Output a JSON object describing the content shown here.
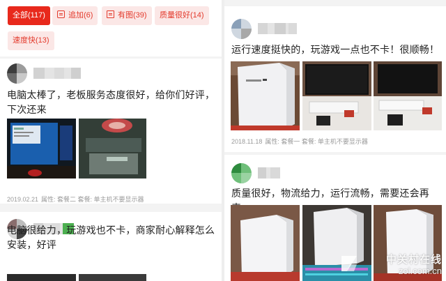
{
  "filters": [
    {
      "label": "全部(117)",
      "active": true,
      "icon": ""
    },
    {
      "label": "追加(6)",
      "active": false,
      "icon": "append-icon"
    },
    {
      "label": "有图(39)",
      "active": false,
      "icon": "image-icon"
    },
    {
      "label": "质量很好(14)",
      "active": false,
      "icon": ""
    },
    {
      "label": "速度快(13)",
      "active": false,
      "icon": ""
    }
  ],
  "reviews_left": [
    {
      "text": "电脑太棒了，老板服务态度很好，给你们好评，下次还来",
      "date": "2019.02.21",
      "attr": "属性: 套餐二 套餐: 单主机不要显示器"
    },
    {
      "text": "电脑很给力，玩游戏也不卡，商家耐心解释怎么安装，好评"
    }
  ],
  "reviews_right": [
    {
      "text": "运行速度挺快的，玩游戏一点也不卡！很顺畅！",
      "date": "2018.11.18",
      "attr": "属性: 套餐一 套餐: 单主机不要显示器"
    },
    {
      "text": "质量很好，物流给力，运行流畅，需要还会再来。"
    }
  ],
  "watermark": {
    "brand": "中关村在线",
    "url": "zol.com.cn",
    "logo_icon": "zol-logo-icon"
  },
  "colors": {
    "accent": "#e8291c",
    "chip_bg": "#fbe7e6",
    "meta": "#9a9a9a"
  }
}
